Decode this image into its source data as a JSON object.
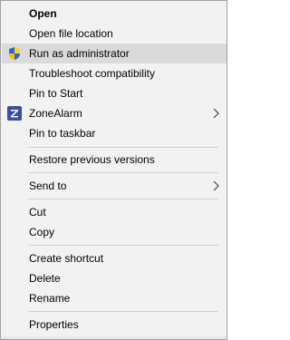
{
  "menu": {
    "items": [
      {
        "label": "Open"
      },
      {
        "label": "Open file location"
      },
      {
        "label": "Run as administrator",
        "icon": "uac-shield-icon"
      },
      {
        "label": "Troubleshoot compatibility"
      },
      {
        "label": "Pin to Start"
      },
      {
        "label": "ZoneAlarm",
        "icon": "zonealarm-icon"
      },
      {
        "label": "Pin to taskbar"
      },
      {
        "label": "Restore previous versions"
      },
      {
        "label": "Send to"
      },
      {
        "label": "Cut"
      },
      {
        "label": "Copy"
      },
      {
        "label": "Create shortcut"
      },
      {
        "label": "Delete"
      },
      {
        "label": "Rename"
      },
      {
        "label": "Properties"
      }
    ]
  },
  "colors": {
    "menu_background": "#f2f2f2",
    "highlight": "#dadada",
    "separator": "#cfcfcf",
    "zonealarm_brand": "#3a4fa3"
  }
}
